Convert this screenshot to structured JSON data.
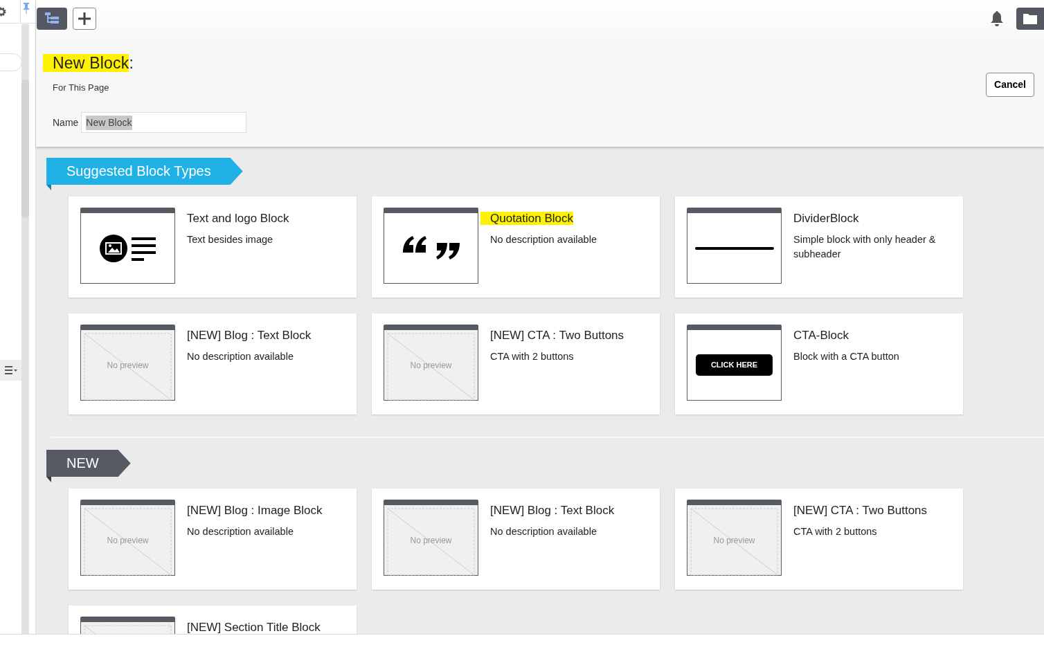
{
  "header": {
    "title": "New Block",
    "title_suffix": ":",
    "title_highlighted": true,
    "subtitle": "For This Page",
    "name_label": "Name",
    "name_value": "New Block",
    "name_value_selected": true,
    "cancel": "Cancel"
  },
  "sections": [
    {
      "title": "Suggested Block Types",
      "kind": "primary",
      "cards": [
        {
          "title": "Text and logo Block",
          "description": "Text besides image",
          "kind": "text-logo",
          "highlighted": false
        },
        {
          "title": "Quotation Block",
          "description": "No description available",
          "kind": "quote",
          "highlighted": true
        },
        {
          "title": "DividerBlock",
          "description": "Simple block with only header & subheader",
          "kind": "divider",
          "highlighted": false
        },
        {
          "title": "[NEW] Blog : Text Block",
          "description": "No description available",
          "kind": "none",
          "preview_label": "No preview",
          "highlighted": false
        },
        {
          "title": "[NEW] CTA : Two Buttons",
          "description": "CTA with 2 buttons",
          "kind": "none",
          "preview_label": "No preview",
          "highlighted": false
        },
        {
          "title": "CTA-Block",
          "description": "Block with a CTA button",
          "kind": "cta",
          "preview_label": "CLICK HERE",
          "highlighted": false
        }
      ]
    },
    {
      "title": "NEW",
      "kind": "dark",
      "cards": [
        {
          "title": "[NEW] Blog : Image Block",
          "description": "No description available",
          "kind": "none",
          "preview_label": "No preview",
          "highlighted": false
        },
        {
          "title": "[NEW] Blog : Text Block",
          "description": "No description available",
          "kind": "none",
          "preview_label": "No preview",
          "highlighted": false
        },
        {
          "title": "[NEW] CTA : Two Buttons",
          "description": "CTA with 2 buttons",
          "kind": "none",
          "preview_label": "No preview",
          "highlighted": false
        },
        {
          "title": "[NEW] Section Title Block",
          "kind": "none",
          "highlighted": false
        }
      ]
    }
  ]
}
